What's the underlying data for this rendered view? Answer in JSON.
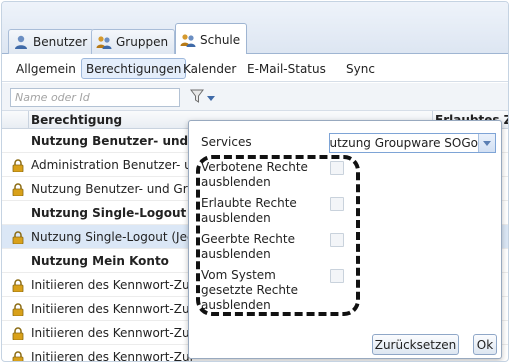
{
  "top_tabs": [
    {
      "label": "Benutzer",
      "icon": "user-icon"
    },
    {
      "label": "Gruppen",
      "icon": "group-icon"
    },
    {
      "label": "Schule",
      "icon": "school-icon"
    }
  ],
  "sub_tabs": [
    "Allgemein",
    "Berechtigungen",
    "Kalender",
    "E-Mail-Status",
    "Sync"
  ],
  "filter": {
    "placeholder": "Name oder Id",
    "value": ""
  },
  "grid": {
    "columns": [
      "Berechtigung",
      "Erlaubtes Zi"
    ],
    "rows": [
      {
        "text": "Nutzung Benutzer- und Gr",
        "group": true,
        "lock": false
      },
      {
        "text": "Administration Benutzer- und",
        "group": false,
        "lock": true
      },
      {
        "text": "Nutzung Benutzer- und Gru",
        "group": false,
        "lock": true
      },
      {
        "text": "Nutzung Single-Logout",
        "group": true,
        "lock": false
      },
      {
        "text": "Nutzung Single-Logout (Jed",
        "group": false,
        "lock": true,
        "selected": true
      },
      {
        "text": "Nutzung Mein Konto",
        "group": true,
        "lock": false
      },
      {
        "text": "Initiieren des Kennwort-Zur",
        "group": false,
        "lock": true
      },
      {
        "text": "Initiieren des Kennwort-Zur",
        "group": false,
        "lock": true
      },
      {
        "text": "Initiieren des Kennwort-Zur",
        "group": false,
        "lock": true
      },
      {
        "text": "Initiieren des Kennwort-Zur",
        "group": false,
        "lock": true
      }
    ]
  },
  "popup": {
    "services_label": "Services",
    "services_value": "Nutzung Groupware SOGo",
    "options": [
      {
        "line1": "Verbotene Rechte",
        "line2": "ausblenden",
        "line3": "",
        "checked": false
      },
      {
        "line1": "Erlaubte Rechte",
        "line2": "ausblenden",
        "line3": "",
        "checked": false
      },
      {
        "line1": "Geerbte Rechte",
        "line2": "ausblenden",
        "line3": "",
        "checked": false
      },
      {
        "line1": "Vom System",
        "line2": "gesetzte Rechte",
        "line3": "ausblenden",
        "checked": false
      }
    ],
    "reset_label": "Zurücksetzen",
    "ok_label": "Ok"
  },
  "colors": {
    "accent": "#4a7fc1",
    "selected_row": "#dbe7f6",
    "lock": "#d9a11a"
  }
}
